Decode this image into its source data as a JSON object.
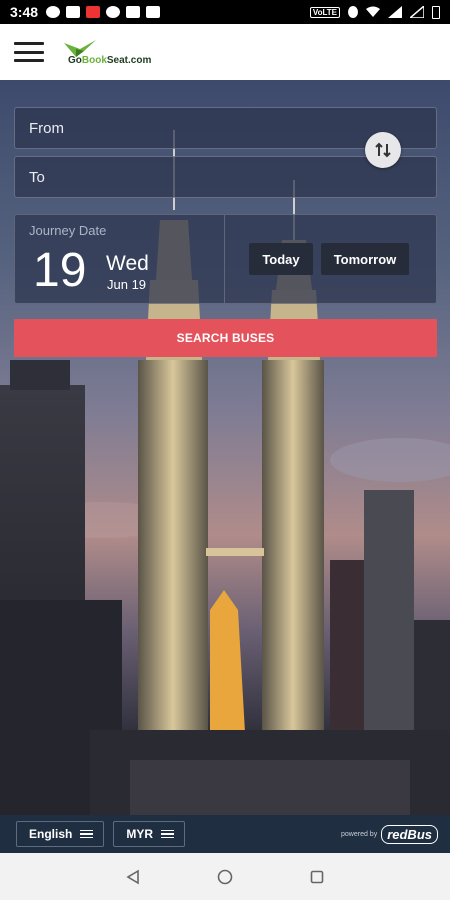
{
  "status_bar": {
    "time": "3:48",
    "network_label": "VoLTE"
  },
  "header": {
    "menu_icon": "hamburger-icon",
    "logo_text_prefix": "Go",
    "logo_text_book": "Book",
    "logo_text_suffix": "Seat.com"
  },
  "form": {
    "from_placeholder": "From",
    "to_placeholder": "To",
    "swap_icon": "swap-vertical-icon",
    "journey_date_label": "Journey Date",
    "day_number": "19",
    "weekday": "Wed",
    "month_day": "Jun 19",
    "today_label": "Today",
    "tomorrow_label": "Tomorrow",
    "search_label": "SEARCH BUSES"
  },
  "footer": {
    "language_label": "English",
    "currency_label": "MYR",
    "powered_by": "powered by",
    "partner": "redBus"
  },
  "colors": {
    "accent": "#e4525b",
    "footer_bg": "#1f2e40",
    "field_bg": "#2c344e"
  }
}
